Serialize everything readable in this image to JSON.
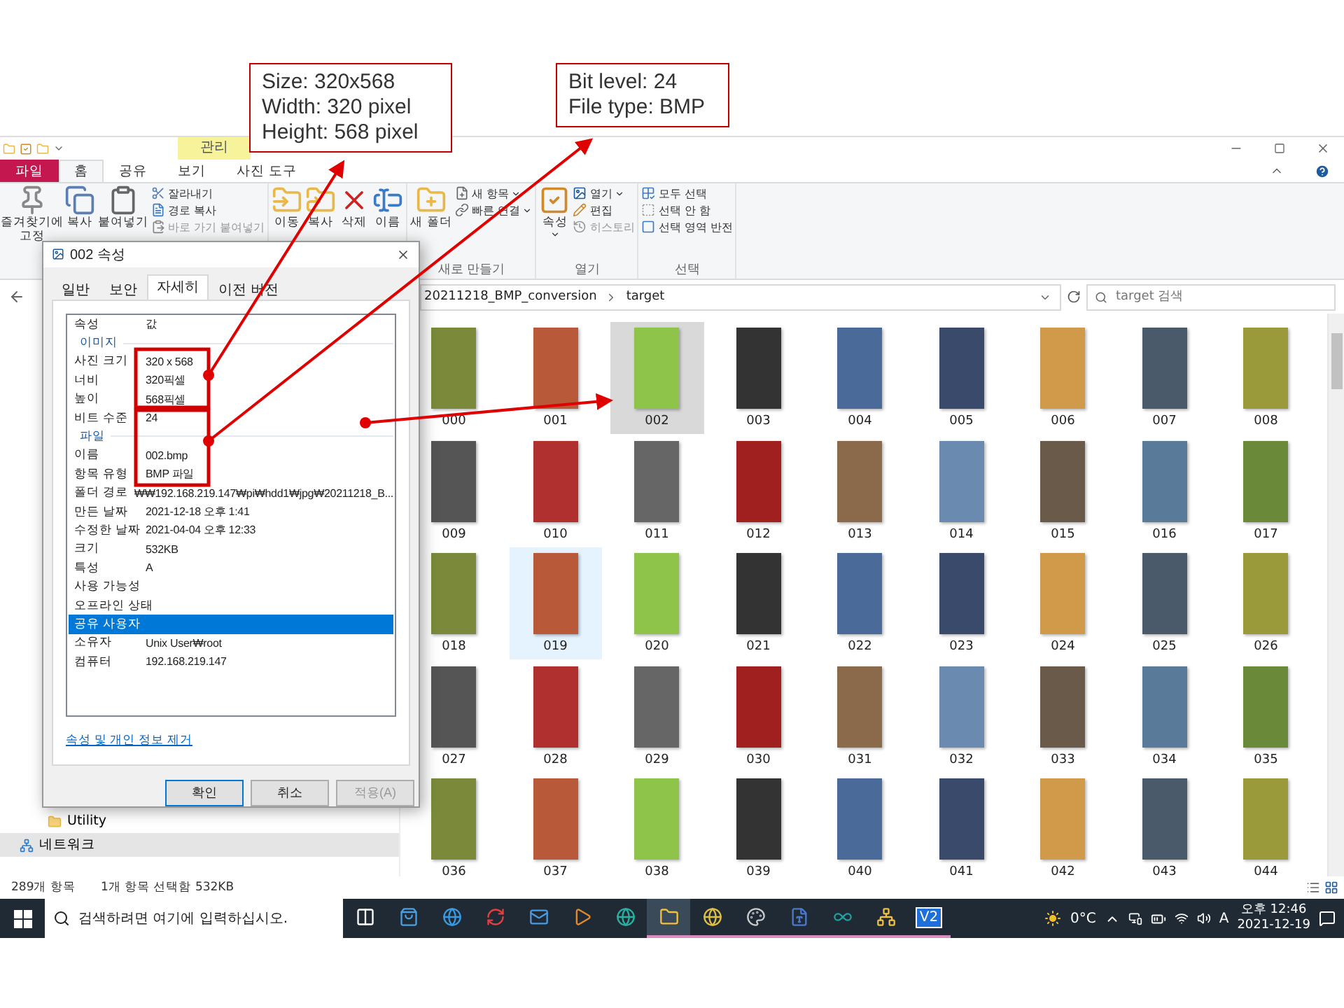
{
  "callouts": [
    {
      "lines": [
        "Size: 320x568",
        "Width: 320 pixel",
        "Height: 568 pixel"
      ]
    },
    {
      "lines": [
        "Bit level: 24",
        "File type: BMP"
      ]
    }
  ],
  "explorer": {
    "context_tab": "관리",
    "tabs": [
      {
        "label": "파일",
        "kind": "file",
        "selected": false
      },
      {
        "label": "홈",
        "kind": "normal",
        "selected": true
      },
      {
        "label": "공유",
        "kind": "normal",
        "selected": false
      },
      {
        "label": "보기",
        "kind": "normal",
        "selected": false
      },
      {
        "label": "사진 도구",
        "kind": "normal",
        "selected": false
      }
    ],
    "ribbon": [
      {
        "items": [
          {
            "label": "즐겨찾기에 고정",
            "kind": "large",
            "disabled": false,
            "menu": false
          },
          {
            "label": "복사",
            "kind": "large",
            "disabled": false,
            "menu": false
          },
          {
            "label": "붙여넣기",
            "kind": "large",
            "disabled": false,
            "menu": false
          },
          {
            "label": "잘라내기",
            "kind": "small",
            "disabled": false,
            "menu": false
          },
          {
            "label": "경로 복사",
            "kind": "small",
            "disabled": false,
            "menu": false
          },
          {
            "label": "바로 가기 붙여넣기",
            "kind": "small",
            "disabled": true,
            "menu": false
          }
        ]
      },
      {
        "items": [
          {
            "label": "이동",
            "kind": "large",
            "disabled": false,
            "menu": false
          },
          {
            "label": "복사",
            "kind": "large",
            "disabled": false,
            "menu": false
          },
          {
            "label": "삭제",
            "kind": "large",
            "disabled": false,
            "menu": false
          },
          {
            "label": "이름",
            "kind": "large",
            "disabled": false,
            "menu": false
          }
        ]
      },
      {
        "label": "새로 만들기",
        "items": [
          {
            "label": "새 폴더",
            "kind": "large",
            "disabled": false,
            "menu": false
          },
          {
            "label": "새 항목",
            "kind": "small",
            "disabled": false,
            "menu": true
          },
          {
            "label": "빠른 연결",
            "kind": "small",
            "disabled": false,
            "menu": true
          }
        ]
      },
      {
        "label": "열기",
        "items": [
          {
            "label": "속성",
            "kind": "large",
            "disabled": false,
            "menu": true
          },
          {
            "label": "열기",
            "kind": "small",
            "disabled": false,
            "menu": true
          },
          {
            "label": "편집",
            "kind": "small",
            "disabled": false,
            "menu": false
          },
          {
            "label": "히스토리",
            "kind": "small",
            "disabled": true,
            "menu": false
          }
        ]
      },
      {
        "label": "선택",
        "items": [
          {
            "label": "모두 선택",
            "kind": "small",
            "disabled": false,
            "menu": false
          },
          {
            "label": "선택 안 함",
            "kind": "small",
            "disabled": false,
            "menu": false
          },
          {
            "label": "선택 영역 반전",
            "kind": "small",
            "disabled": false,
            "menu": false
          }
        ]
      }
    ],
    "breadcrumbs": [
      "20211218_BMP_conversion",
      "target"
    ],
    "search": {
      "placeholder": "target 검색"
    },
    "nav_items": [
      {
        "label": "Utility",
        "kind": "folder",
        "selected": false
      },
      {
        "label": "네트워크",
        "kind": "network",
        "selected": true
      }
    ],
    "files": [
      {
        "label": "000",
        "selected": false,
        "hover": false
      },
      {
        "label": "001",
        "selected": false,
        "hover": false
      },
      {
        "label": "002",
        "selected": true,
        "hover": false
      },
      {
        "label": "003",
        "selected": false,
        "hover": false
      },
      {
        "label": "004",
        "selected": false,
        "hover": false
      },
      {
        "label": "005",
        "selected": false,
        "hover": false
      },
      {
        "label": "006",
        "selected": false,
        "hover": false
      },
      {
        "label": "007",
        "selected": false,
        "hover": false
      },
      {
        "label": "008",
        "selected": false,
        "hover": false
      },
      {
        "label": "009",
        "selected": false,
        "hover": false
      },
      {
        "label": "010",
        "selected": false,
        "hover": false
      },
      {
        "label": "011",
        "selected": false,
        "hover": false
      },
      {
        "label": "012",
        "selected": false,
        "hover": false
      },
      {
        "label": "013",
        "selected": false,
        "hover": false
      },
      {
        "label": "014",
        "selected": false,
        "hover": false
      },
      {
        "label": "015",
        "selected": false,
        "hover": false
      },
      {
        "label": "016",
        "selected": false,
        "hover": false
      },
      {
        "label": "017",
        "selected": false,
        "hover": false
      },
      {
        "label": "018",
        "selected": false,
        "hover": false
      },
      {
        "label": "019",
        "selected": false,
        "hover": true
      },
      {
        "label": "020",
        "selected": false,
        "hover": false
      },
      {
        "label": "021",
        "selected": false,
        "hover": false
      },
      {
        "label": "022",
        "selected": false,
        "hover": false
      },
      {
        "label": "023",
        "selected": false,
        "hover": false
      },
      {
        "label": "024",
        "selected": false,
        "hover": false
      },
      {
        "label": "025",
        "selected": false,
        "hover": false
      },
      {
        "label": "026",
        "selected": false,
        "hover": false
      },
      {
        "label": "027",
        "selected": false,
        "hover": false
      },
      {
        "label": "028",
        "selected": false,
        "hover": false
      },
      {
        "label": "029",
        "selected": false,
        "hover": false
      },
      {
        "label": "030",
        "selected": false,
        "hover": false
      },
      {
        "label": "031",
        "selected": false,
        "hover": false
      },
      {
        "label": "032",
        "selected": false,
        "hover": false
      },
      {
        "label": "033",
        "selected": false,
        "hover": false
      },
      {
        "label": "034",
        "selected": false,
        "hover": false
      },
      {
        "label": "035",
        "selected": false,
        "hover": false
      },
      {
        "label": "036",
        "selected": false,
        "hover": false
      },
      {
        "label": "037",
        "selected": false,
        "hover": false
      },
      {
        "label": "038",
        "selected": false,
        "hover": false
      },
      {
        "label": "039",
        "selected": false,
        "hover": false
      },
      {
        "label": "040",
        "selected": false,
        "hover": false
      },
      {
        "label": "041",
        "selected": false,
        "hover": false
      },
      {
        "label": "042",
        "selected": false,
        "hover": false
      },
      {
        "label": "043",
        "selected": false,
        "hover": false
      },
      {
        "label": "044",
        "selected": false,
        "hover": false
      }
    ],
    "status_bar": {
      "count": "289개 항목",
      "selection": "1개 항목 선택함 532KB"
    }
  },
  "dialog": {
    "title": "002 속성",
    "tabs": [
      {
        "label": "일반",
        "selected": false
      },
      {
        "label": "보안",
        "selected": false
      },
      {
        "label": "자세히",
        "selected": true
      },
      {
        "label": "이전 버전",
        "selected": false
      }
    ],
    "columns": [
      "속성",
      "값"
    ],
    "rows": [
      {
        "kind": "section",
        "name": "이미지",
        "selected": false
      },
      {
        "kind": "property",
        "name": "사진 크기",
        "value": "320 x 568",
        "selected": false
      },
      {
        "kind": "property",
        "name": "너비",
        "value": "320픽셀",
        "selected": false
      },
      {
        "kind": "property",
        "name": "높이",
        "value": "568픽셀",
        "selected": false
      },
      {
        "kind": "property",
        "name": "비트 수준",
        "value": "24",
        "selected": false
      },
      {
        "kind": "section",
        "name": "파일",
        "selected": false
      },
      {
        "kind": "property",
        "name": "이름",
        "value": "002.bmp",
        "selected": false
      },
      {
        "kind": "property",
        "name": "항목 유형",
        "value": "BMP 파일",
        "selected": false
      },
      {
        "kind": "property",
        "name": "폴더 경로",
        "value": "₩₩192.168.219.147₩pi₩hdd1₩jpg₩20211218_B...",
        "selected": false
      },
      {
        "kind": "property",
        "name": "만든 날짜",
        "value": "2021-12-18 오후 1:41",
        "selected": false
      },
      {
        "kind": "property",
        "name": "수정한 날짜",
        "value": "2021-04-04 오후 12:33",
        "selected": false
      },
      {
        "kind": "property",
        "name": "크기",
        "value": "532KB",
        "selected": false
      },
      {
        "kind": "property",
        "name": "특성",
        "value": "A",
        "selected": false
      },
      {
        "kind": "property",
        "name": "사용 가능성",
        "value": "",
        "selected": false
      },
      {
        "kind": "property",
        "name": "오프라인 상태",
        "value": "",
        "selected": false
      },
      {
        "kind": "property",
        "name": "공유 사용자",
        "value": "",
        "selected": true
      },
      {
        "kind": "property",
        "name": "소유자",
        "value": "Unix User₩root",
        "selected": false
      },
      {
        "kind": "property",
        "name": "컴퓨터",
        "value": "192.168.219.147",
        "selected": false
      }
    ],
    "link": "속성 및 개인 정보 제거",
    "buttons": [
      {
        "label": "확인",
        "default": true,
        "disabled": false
      },
      {
        "label": "취소",
        "default": false,
        "disabled": false
      },
      {
        "label": "적용(A)",
        "default": false,
        "disabled": true
      }
    ]
  },
  "taskbar": {
    "search": {
      "placeholder": "검색하려면 여기에 입력하십시오."
    },
    "apps": [
      {
        "running": false,
        "active": false
      },
      {
        "running": false,
        "active": false
      },
      {
        "running": false,
        "active": false
      },
      {
        "running": false,
        "active": false
      },
      {
        "running": false,
        "active": false
      },
      {
        "running": false,
        "active": false
      },
      {
        "running": false,
        "active": false
      },
      {
        "running": true,
        "active": true
      },
      {
        "running": true,
        "active": false
      },
      {
        "running": true,
        "active": false
      },
      {
        "running": true,
        "active": false
      },
      {
        "running": true,
        "active": false
      },
      {
        "running": true,
        "active": false
      },
      {
        "running": true,
        "active": false,
        "text": "V2"
      }
    ],
    "temperature": "0°C",
    "ime": "A",
    "time": "오후 12:46",
    "date": "2021-12-19"
  }
}
